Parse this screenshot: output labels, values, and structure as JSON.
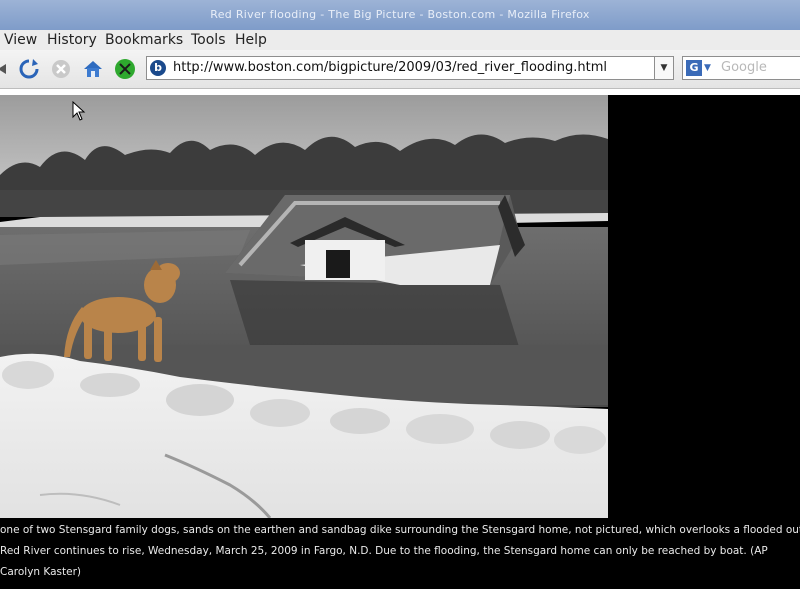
{
  "window": {
    "title": "Red River flooding - The Big Picture - Boston.com - Mozilla Firefox"
  },
  "menu": {
    "items": [
      "View",
      "History",
      "Bookmarks",
      "Tools",
      "Help"
    ]
  },
  "navbar": {
    "url": "http://www.boston.com/bigpicture/2009/03/red_river_flooding.html",
    "search_placeholder": "Google",
    "icons": [
      "back-arrow-icon",
      "reload-icon",
      "stop-icon",
      "home-icon",
      "addon-icon",
      "site-favicon",
      "rss-feed-icon",
      "bookmark-star-icon",
      "dropdown-icon",
      "google-search-icon"
    ]
  },
  "photo": {
    "caption_lines": [
      "one of two Stensgard family dogs, sands on the earthen and sandbag dike surrounding the Stensgard home, not pictured, which overlooks a flooded outbuild",
      "Red River continues to rise, Wednesday, March 25, 2009 in Fargo, N.D. Due to the flooding, the Stensgard home can only be reached by boat. (AP",
      "Carolyn Kaster)"
    ]
  },
  "colors": {
    "titlebar": "#8aa6d0",
    "page_background": "#000000",
    "caption_text": "#eaeaea"
  }
}
